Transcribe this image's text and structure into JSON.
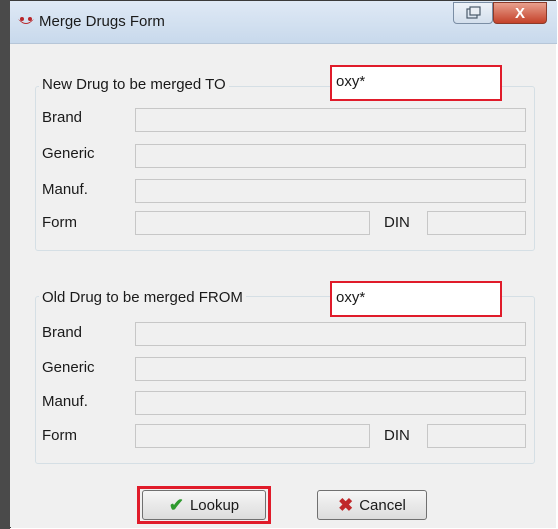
{
  "window": {
    "title": "Merge Drugs Form",
    "close_glyph": "X"
  },
  "new_drug": {
    "group_label": "New Drug to be merged TO",
    "search_value": "oxy*",
    "brand_label": "Brand",
    "generic_label": "Generic",
    "manuf_label": "Manuf.",
    "form_label": "Form",
    "din_label": "DIN",
    "brand_value": "",
    "generic_value": "",
    "manuf_value": "",
    "form_value": "",
    "din_value": ""
  },
  "old_drug": {
    "group_label": "Old Drug to be merged FROM",
    "search_value": "oxy*",
    "brand_label": "Brand",
    "generic_label": "Generic",
    "manuf_label": "Manuf.",
    "form_label": "Form",
    "din_label": "DIN",
    "brand_value": "",
    "generic_value": "",
    "manuf_value": "",
    "form_value": "",
    "din_value": ""
  },
  "buttons": {
    "lookup_label": "Lookup",
    "cancel_label": "Cancel",
    "lookup_icon": "checkmark-icon",
    "cancel_icon": "x-icon"
  },
  "colors": {
    "highlight": "#e01b2a",
    "check": "#2e9a2e",
    "cancel_x": "#c0282a"
  }
}
